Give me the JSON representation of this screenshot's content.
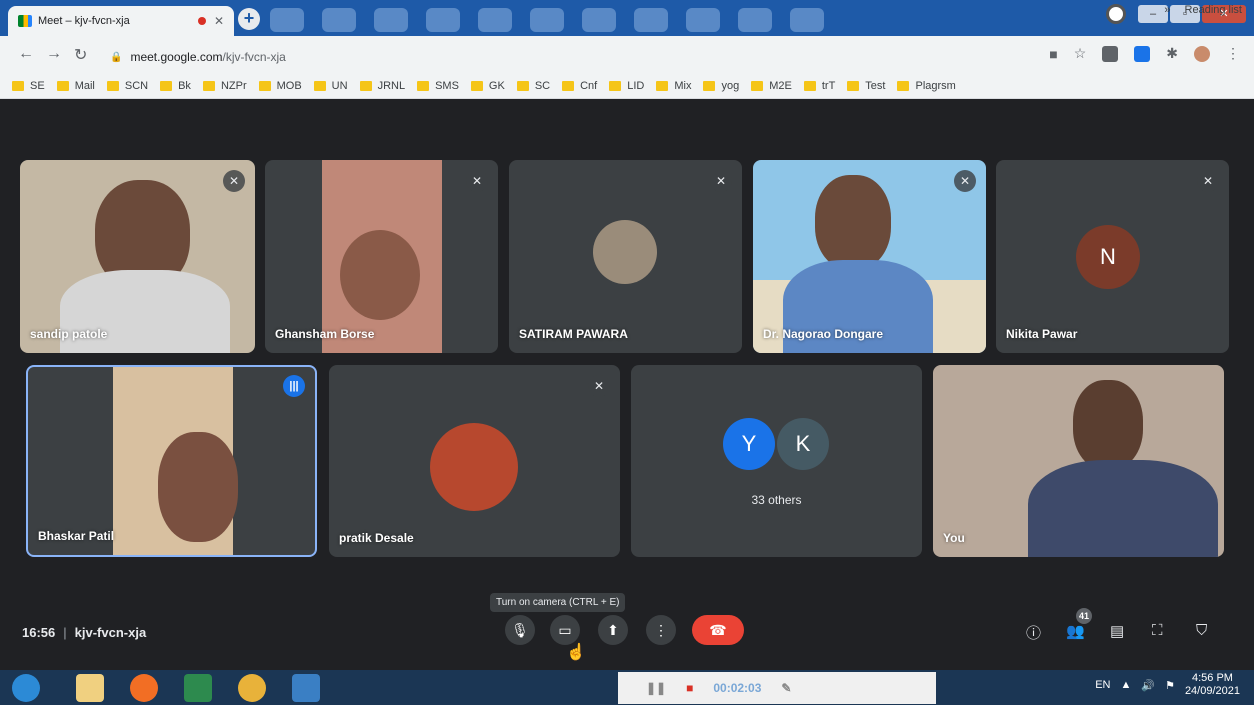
{
  "browser": {
    "tab_title": "Meet – kjv-fvcn-xja",
    "new_tab": "+",
    "address_domain": "meet.google.com",
    "address_path": "/kjv-fvcn-xja",
    "bookmarks": [
      "SE",
      "Mail",
      "SCN",
      "Bk",
      "NZPr",
      "MOB",
      "UN",
      "JRNL",
      "SMS",
      "GK",
      "SC",
      "Cnf",
      "LID",
      "Mix",
      "yog",
      "M2E",
      "trT",
      "Test",
      "Plagrsm"
    ],
    "reading_list": "Reading list",
    "overflow": "»"
  },
  "participants": [
    {
      "name": "sandip patole",
      "muted": true
    },
    {
      "name": "Ghansham Borse",
      "muted": true
    },
    {
      "name": "SATIRAM PAWARA",
      "muted": true
    },
    {
      "name": "Dr. Nagorao Dongare",
      "muted": true
    },
    {
      "name": "Nikita Pawar",
      "muted": true,
      "initial": "N"
    },
    {
      "name": "Bhaskar Patil",
      "speaking": true
    },
    {
      "name": "pratik Desale",
      "muted": true
    },
    {
      "name": "33 others",
      "initials": [
        "Y",
        "K"
      ]
    },
    {
      "name": "You"
    }
  ],
  "controls": {
    "tooltip": "Turn on camera (CTRL + E)",
    "time": "16:56",
    "meeting_code": "kjv-fvcn-xja",
    "people_count": "41"
  },
  "taskbar": {
    "lang": "EN",
    "time": "4:56 PM",
    "date": "24/09/2021",
    "recorder_time": "00:02:03"
  },
  "colors": {
    "accent": "#1a73e8",
    "end_call": "#ea4335",
    "nikita_avatar": "#7b3b2a"
  }
}
